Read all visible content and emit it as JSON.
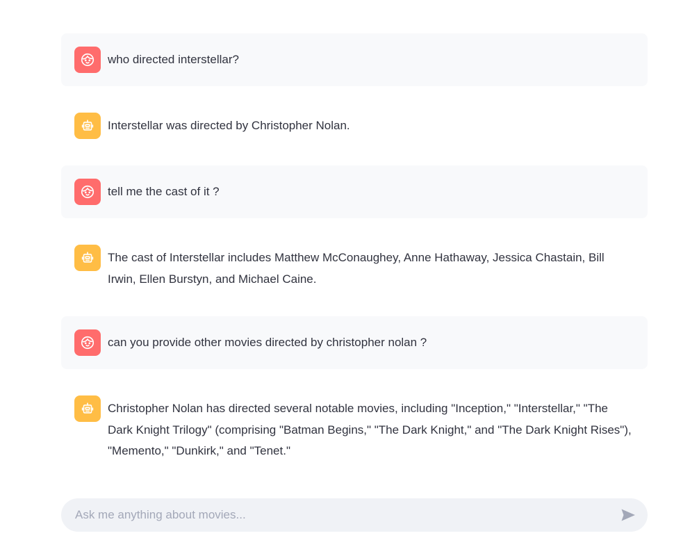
{
  "colors": {
    "user_avatar_bg": "#ff6c6c",
    "assistant_avatar_bg": "#ffbd45",
    "user_message_bg": "#f8f9fb",
    "input_bg": "#f0f2f6",
    "text": "#31333f",
    "placeholder": "#a3a8b8",
    "send_icon": "#a3a8b8"
  },
  "messages": [
    {
      "role": "user",
      "avatar_icon": "smiley-face-icon",
      "text": "who directed interstellar?"
    },
    {
      "role": "assistant",
      "avatar_icon": "robot-icon",
      "text": "Interstellar was directed by Christopher Nolan."
    },
    {
      "role": "user",
      "avatar_icon": "smiley-face-icon",
      "text": "tell me the cast of it ?"
    },
    {
      "role": "assistant",
      "avatar_icon": "robot-icon",
      "text": "The cast of Interstellar includes Matthew McConaughey, Anne Hathaway, Jessica Chastain, Bill Irwin, Ellen Burstyn, and Michael Caine."
    },
    {
      "role": "user",
      "avatar_icon": "smiley-face-icon",
      "text": "can you provide other movies directed by christopher nolan ?"
    },
    {
      "role": "assistant",
      "avatar_icon": "robot-icon",
      "text": "Christopher Nolan has directed several notable movies, including \"Inception,\" \"Interstellar,\" \"The Dark Knight Trilogy\" (comprising \"Batman Begins,\" \"The Dark Knight,\" and \"The Dark Knight Rises\"), \"Memento,\" \"Dunkirk,\" and \"Tenet.\""
    }
  ],
  "chat_input": {
    "placeholder": "Ask me anything about movies...",
    "value": "",
    "send_icon": "send-arrow-icon"
  }
}
